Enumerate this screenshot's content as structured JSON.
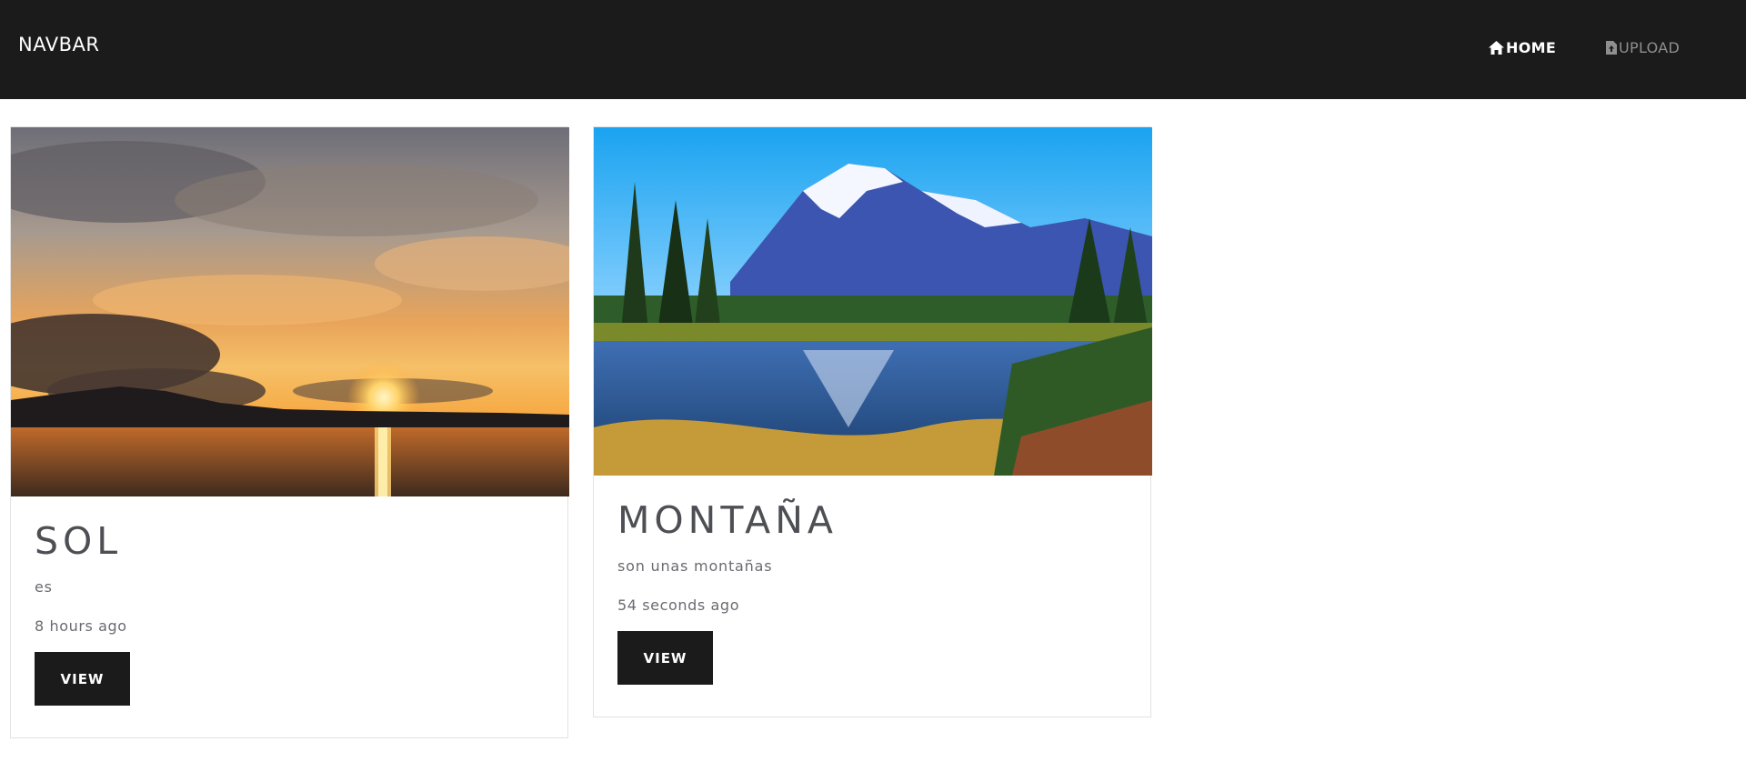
{
  "navbar": {
    "brand": "NAVBAR",
    "links": [
      {
        "label": "HOME",
        "icon": "home-icon",
        "active": true
      },
      {
        "label": "UPLOAD",
        "icon": "file-upload-icon",
        "active": false
      }
    ]
  },
  "cards": [
    {
      "title": "SOL",
      "description": "es",
      "time": "8 hours ago",
      "button_label": "VIEW",
      "image": "sunset-over-lake-image"
    },
    {
      "title": "MONTAÑA",
      "description": "son unas montañas",
      "time": "54 seconds ago",
      "button_label": "VIEW",
      "image": "mountain-lake-image"
    }
  ],
  "colors": {
    "navbar_bg": "#1b1b1b",
    "button_bg": "#1b1b1b",
    "title_text": "#4e4f54",
    "muted_text": "#6a6b70",
    "inactive_link": "#8f8f8f"
  }
}
